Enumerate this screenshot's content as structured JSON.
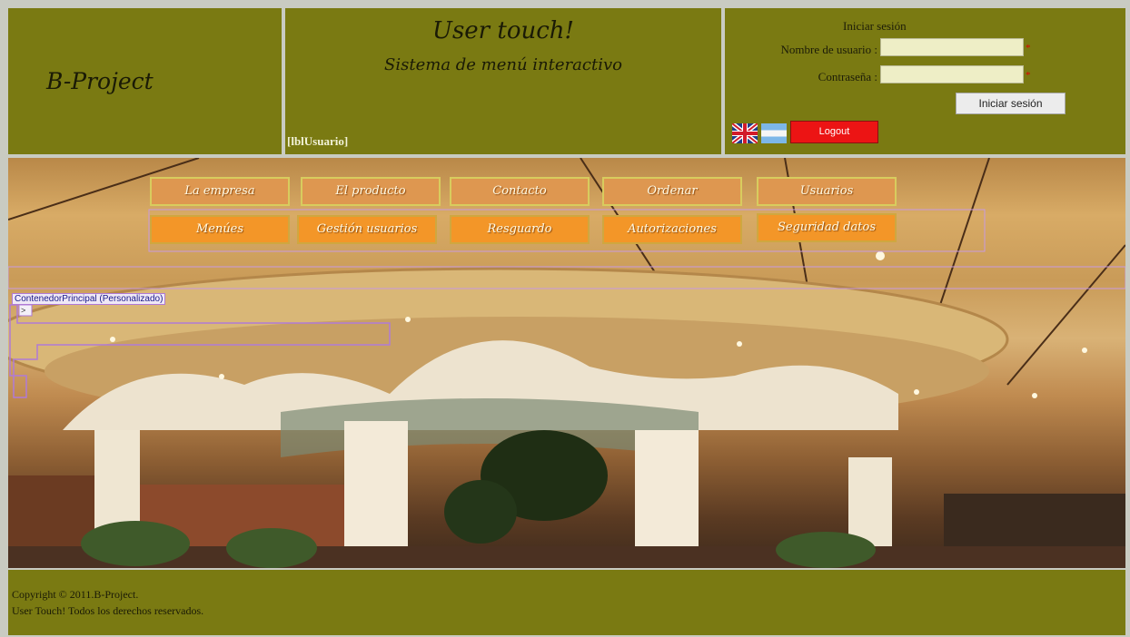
{
  "header": {
    "logo": "B-Project",
    "app_title": "User touch!",
    "app_subtitle": "Sistema de menú interactivo",
    "user_label": "[lblUsuario]"
  },
  "login": {
    "title": "Iniciar sesión",
    "username_label": "Nombre de usuario :",
    "password_label": "Contraseña :",
    "username_value": "",
    "password_value": "",
    "required_marker": "*",
    "submit_label": "Iniciar sesión",
    "logout_label": "Logout",
    "flags": [
      "uk-flag-icon",
      "argentina-flag-icon"
    ]
  },
  "menu": {
    "row1": [
      "La empresa",
      "El producto",
      "Contacto",
      "Ordenar",
      "Usuarios"
    ],
    "row2": [
      "Menúes",
      "Gestión usuarios",
      "Resguardo",
      "Autorizaciones",
      "Seguridad datos"
    ]
  },
  "designer": {
    "container_label": "ContenedorPrincipal (Personalizado)",
    "toggle_label": ">"
  },
  "footer": {
    "line1": "Copyright © 2011.B-Project.",
    "line2": "User Touch! Todos los derechos reservados."
  },
  "colors": {
    "header_bg": "#7a7a12",
    "menu_top": "#de9750",
    "menu_bottom": "#f39628",
    "logout_bg": "#ec1414"
  }
}
